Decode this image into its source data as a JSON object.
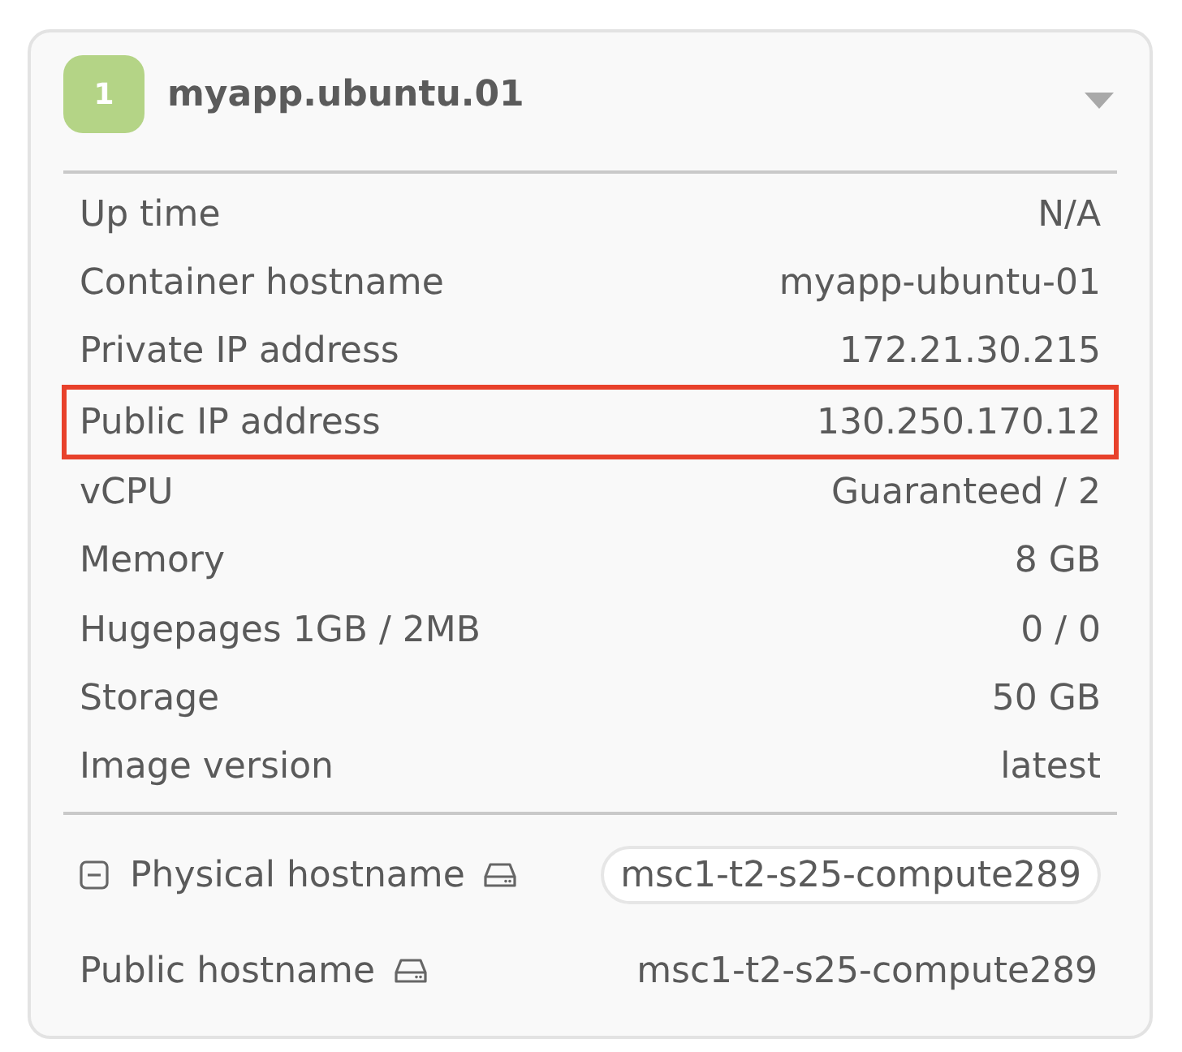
{
  "card": {
    "badge": "1",
    "title": "myapp.ubuntu.01",
    "expanded": true
  },
  "details": [
    {
      "label": "Up time",
      "value": "N/A",
      "highlighted": false
    },
    {
      "label": "Container hostname",
      "value": "myapp-ubuntu-01",
      "highlighted": false
    },
    {
      "label": "Private IP address",
      "value": "172.21.30.215",
      "highlighted": false
    },
    {
      "label": "Public IP address",
      "value": "130.250.170.12",
      "highlighted": true
    },
    {
      "label": "vCPU",
      "value": "Guaranteed / 2",
      "highlighted": false
    },
    {
      "label": "Memory",
      "value": "8 GB",
      "highlighted": false
    },
    {
      "label": "Hugepages 1GB / 2MB",
      "value": "0 / 0",
      "highlighted": false
    },
    {
      "label": "Storage",
      "value": "50 GB",
      "highlighted": false
    },
    {
      "label": "Image version",
      "value": "latest",
      "highlighted": false
    }
  ],
  "physical_hostname": {
    "label": "Physical hostname",
    "value": "msc1-t2-s25-compute289",
    "expanded": true
  },
  "public_hostname": {
    "label": "Public hostname",
    "value": "msc1-t2-s25-compute289"
  }
}
